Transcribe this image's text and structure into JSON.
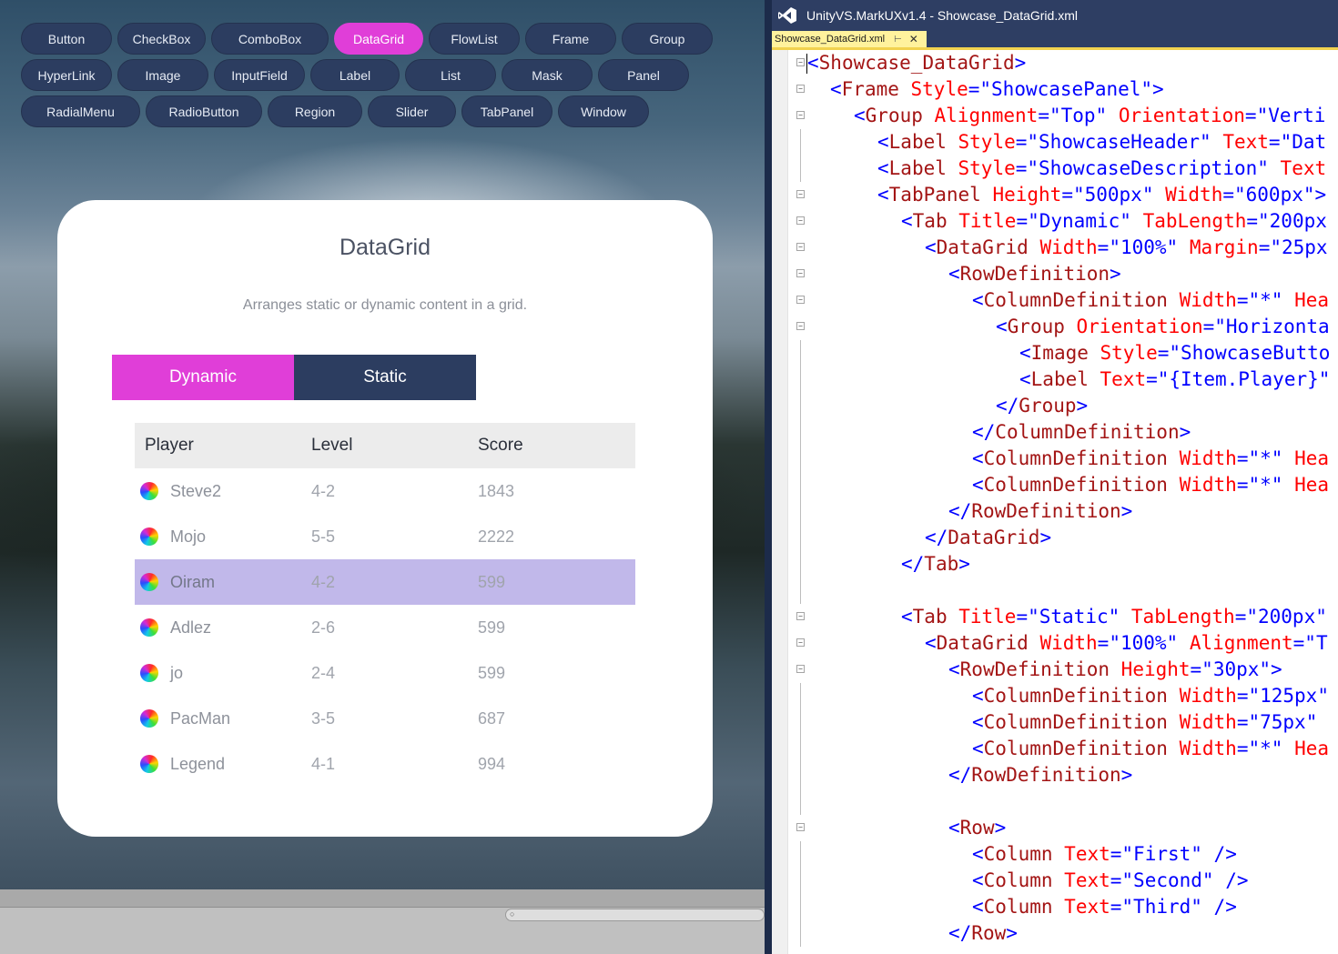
{
  "nav": {
    "rows": [
      [
        "Button",
        "CheckBox",
        "ComboBox",
        "DataGrid",
        "FlowList",
        "Frame",
        "Group"
      ],
      [
        "HyperLink",
        "Image",
        "InputField",
        "Label",
        "List",
        "Mask",
        "Panel"
      ],
      [
        "RadialMenu",
        "RadioButton",
        "Region",
        "Slider",
        "TabPanel",
        "Window"
      ]
    ],
    "active": "DataGrid"
  },
  "showcase": {
    "title": "DataGrid",
    "description": "Arranges static or dynamic content in a grid.",
    "tabs": [
      "Dynamic",
      "Static"
    ],
    "active_tab": "Dynamic",
    "grid": {
      "headers": [
        "Player",
        "Level",
        "Score"
      ],
      "rows": [
        {
          "player": "Steve2",
          "level": "4-2",
          "score": "1843"
        },
        {
          "player": "Mojo",
          "level": "5-5",
          "score": "2222"
        },
        {
          "player": "Oiram",
          "level": "4-2",
          "score": "599",
          "selected": true
        },
        {
          "player": "Adlez",
          "level": "2-6",
          "score": "599"
        },
        {
          "player": "jo",
          "level": "2-4",
          "score": "599"
        },
        {
          "player": "PacMan",
          "level": "3-5",
          "score": "687"
        },
        {
          "player": "Legend",
          "level": "4-1",
          "score": "994"
        }
      ]
    }
  },
  "colors": {
    "accent": "#e03ed8",
    "nav_bg": "#2c3d60",
    "selected_row": "#c1b8ea",
    "vs_titlebar": "#2e3e63",
    "doc_tab": "#fff29d"
  },
  "vs": {
    "window_title": "UnityVS.MarkUXv1.4 - Showcase_DataGrid.xml",
    "doc_tab": "Showcase_DataGrid.xml",
    "code_lines": [
      {
        "indent": 0,
        "fold": true,
        "parts": [
          [
            "p",
            "<"
          ],
          [
            "t",
            "Showcase_DataGrid"
          ],
          [
            "p",
            ">"
          ]
        ]
      },
      {
        "indent": 1,
        "fold": true,
        "parts": [
          [
            "p",
            "<"
          ],
          [
            "t",
            "Frame "
          ],
          [
            "a",
            "Style"
          ],
          [
            "p",
            "=\""
          ],
          [
            "v",
            "ShowcasePanel"
          ],
          [
            "p",
            "\">"
          ]
        ]
      },
      {
        "indent": 2,
        "fold": true,
        "parts": [
          [
            "p",
            "<"
          ],
          [
            "t",
            "Group "
          ],
          [
            "a",
            "Alignment"
          ],
          [
            "p",
            "=\""
          ],
          [
            "v",
            "Top"
          ],
          [
            "p",
            "\" "
          ],
          [
            "a",
            "Orientation"
          ],
          [
            "p",
            "=\""
          ],
          [
            "v",
            "Verti"
          ]
        ]
      },
      {
        "indent": 3,
        "fold": false,
        "parts": [
          [
            "p",
            "<"
          ],
          [
            "t",
            "Label "
          ],
          [
            "a",
            "Style"
          ],
          [
            "p",
            "=\""
          ],
          [
            "v",
            "ShowcaseHeader"
          ],
          [
            "p",
            "\" "
          ],
          [
            "a",
            "Text"
          ],
          [
            "p",
            "=\""
          ],
          [
            "v",
            "Dat"
          ]
        ]
      },
      {
        "indent": 3,
        "fold": false,
        "parts": [
          [
            "p",
            "<"
          ],
          [
            "t",
            "Label "
          ],
          [
            "a",
            "Style"
          ],
          [
            "p",
            "=\""
          ],
          [
            "v",
            "ShowcaseDescription"
          ],
          [
            "p",
            "\" "
          ],
          [
            "a",
            "Text"
          ]
        ]
      },
      {
        "indent": 3,
        "fold": true,
        "parts": [
          [
            "p",
            "<"
          ],
          [
            "t",
            "TabPanel "
          ],
          [
            "a",
            "Height"
          ],
          [
            "p",
            "=\""
          ],
          [
            "v",
            "500px"
          ],
          [
            "p",
            "\" "
          ],
          [
            "a",
            "Width"
          ],
          [
            "p",
            "=\""
          ],
          [
            "v",
            "600px"
          ],
          [
            "p",
            "\">"
          ]
        ]
      },
      {
        "indent": 4,
        "fold": true,
        "parts": [
          [
            "p",
            "<"
          ],
          [
            "t",
            "Tab "
          ],
          [
            "a",
            "Title"
          ],
          [
            "p",
            "=\""
          ],
          [
            "v",
            "Dynamic"
          ],
          [
            "p",
            "\" "
          ],
          [
            "a",
            "TabLength"
          ],
          [
            "p",
            "=\""
          ],
          [
            "v",
            "200px"
          ]
        ]
      },
      {
        "indent": 5,
        "fold": true,
        "parts": [
          [
            "p",
            "<"
          ],
          [
            "t",
            "DataGrid "
          ],
          [
            "a",
            "Width"
          ],
          [
            "p",
            "=\""
          ],
          [
            "v",
            "100%"
          ],
          [
            "p",
            "\" "
          ],
          [
            "a",
            "Margin"
          ],
          [
            "p",
            "=\""
          ],
          [
            "v",
            "25px"
          ]
        ]
      },
      {
        "indent": 6,
        "fold": true,
        "parts": [
          [
            "p",
            "<"
          ],
          [
            "t",
            "RowDefinition"
          ],
          [
            "p",
            ">"
          ]
        ]
      },
      {
        "indent": 7,
        "fold": true,
        "parts": [
          [
            "p",
            "<"
          ],
          [
            "t",
            "ColumnDefinition "
          ],
          [
            "a",
            "Width"
          ],
          [
            "p",
            "=\""
          ],
          [
            "v",
            "*"
          ],
          [
            "p",
            "\" "
          ],
          [
            "a",
            "Hea"
          ]
        ]
      },
      {
        "indent": 8,
        "fold": true,
        "parts": [
          [
            "p",
            "<"
          ],
          [
            "t",
            "Group "
          ],
          [
            "a",
            "Orientation"
          ],
          [
            "p",
            "=\""
          ],
          [
            "v",
            "Horizonta"
          ]
        ]
      },
      {
        "indent": 9,
        "fold": false,
        "parts": [
          [
            "p",
            "<"
          ],
          [
            "t",
            "Image "
          ],
          [
            "a",
            "Style"
          ],
          [
            "p",
            "=\""
          ],
          [
            "v",
            "ShowcaseButto"
          ]
        ]
      },
      {
        "indent": 9,
        "fold": false,
        "parts": [
          [
            "p",
            "<"
          ],
          [
            "t",
            "Label "
          ],
          [
            "a",
            "Text"
          ],
          [
            "p",
            "=\""
          ],
          [
            "v",
            "{Item.Player}"
          ],
          [
            "p",
            "\""
          ]
        ]
      },
      {
        "indent": 8,
        "fold": false,
        "parts": [
          [
            "p",
            "</"
          ],
          [
            "t",
            "Group"
          ],
          [
            "p",
            ">"
          ]
        ]
      },
      {
        "indent": 7,
        "fold": false,
        "parts": [
          [
            "p",
            "</"
          ],
          [
            "t",
            "ColumnDefinition"
          ],
          [
            "p",
            ">"
          ]
        ]
      },
      {
        "indent": 7,
        "fold": false,
        "parts": [
          [
            "p",
            "<"
          ],
          [
            "t",
            "ColumnDefinition "
          ],
          [
            "a",
            "Width"
          ],
          [
            "p",
            "=\""
          ],
          [
            "v",
            "*"
          ],
          [
            "p",
            "\" "
          ],
          [
            "a",
            "Hea"
          ]
        ]
      },
      {
        "indent": 7,
        "fold": false,
        "parts": [
          [
            "p",
            "<"
          ],
          [
            "t",
            "ColumnDefinition "
          ],
          [
            "a",
            "Width"
          ],
          [
            "p",
            "=\""
          ],
          [
            "v",
            "*"
          ],
          [
            "p",
            "\" "
          ],
          [
            "a",
            "Hea"
          ]
        ]
      },
      {
        "indent": 6,
        "fold": false,
        "parts": [
          [
            "p",
            "</"
          ],
          [
            "t",
            "RowDefinition"
          ],
          [
            "p",
            ">"
          ]
        ]
      },
      {
        "indent": 5,
        "fold": false,
        "parts": [
          [
            "p",
            "</"
          ],
          [
            "t",
            "DataGrid"
          ],
          [
            "p",
            ">"
          ]
        ]
      },
      {
        "indent": 4,
        "fold": false,
        "parts": [
          [
            "p",
            "</"
          ],
          [
            "t",
            "Tab"
          ],
          [
            "p",
            ">"
          ]
        ]
      },
      {
        "indent": 0,
        "fold": false,
        "parts": []
      },
      {
        "indent": 4,
        "fold": true,
        "parts": [
          [
            "p",
            "<"
          ],
          [
            "t",
            "Tab "
          ],
          [
            "a",
            "Title"
          ],
          [
            "p",
            "=\""
          ],
          [
            "v",
            "Static"
          ],
          [
            "p",
            "\" "
          ],
          [
            "a",
            "TabLength"
          ],
          [
            "p",
            "=\""
          ],
          [
            "v",
            "200px"
          ],
          [
            "p",
            "\""
          ]
        ]
      },
      {
        "indent": 5,
        "fold": true,
        "parts": [
          [
            "p",
            "<"
          ],
          [
            "t",
            "DataGrid "
          ],
          [
            "a",
            "Width"
          ],
          [
            "p",
            "=\""
          ],
          [
            "v",
            "100%"
          ],
          [
            "p",
            "\" "
          ],
          [
            "a",
            "Alignment"
          ],
          [
            "p",
            "=\""
          ],
          [
            "v",
            "T"
          ]
        ]
      },
      {
        "indent": 6,
        "fold": true,
        "parts": [
          [
            "p",
            "<"
          ],
          [
            "t",
            "RowDefinition "
          ],
          [
            "a",
            "Height"
          ],
          [
            "p",
            "=\""
          ],
          [
            "v",
            "30px"
          ],
          [
            "p",
            "\">"
          ]
        ]
      },
      {
        "indent": 7,
        "fold": false,
        "parts": [
          [
            "p",
            "<"
          ],
          [
            "t",
            "ColumnDefinition "
          ],
          [
            "a",
            "Width"
          ],
          [
            "p",
            "=\""
          ],
          [
            "v",
            "125px"
          ],
          [
            "p",
            "\""
          ]
        ]
      },
      {
        "indent": 7,
        "fold": false,
        "parts": [
          [
            "p",
            "<"
          ],
          [
            "t",
            "ColumnDefinition "
          ],
          [
            "a",
            "Width"
          ],
          [
            "p",
            "=\""
          ],
          [
            "v",
            "75px"
          ],
          [
            "p",
            "\""
          ]
        ]
      },
      {
        "indent": 7,
        "fold": false,
        "parts": [
          [
            "p",
            "<"
          ],
          [
            "t",
            "ColumnDefinition "
          ],
          [
            "a",
            "Width"
          ],
          [
            "p",
            "=\""
          ],
          [
            "v",
            "*"
          ],
          [
            "p",
            "\" "
          ],
          [
            "a",
            "Hea"
          ]
        ]
      },
      {
        "indent": 6,
        "fold": false,
        "parts": [
          [
            "p",
            "</"
          ],
          [
            "t",
            "RowDefinition"
          ],
          [
            "p",
            ">"
          ]
        ]
      },
      {
        "indent": 0,
        "fold": false,
        "parts": []
      },
      {
        "indent": 6,
        "fold": true,
        "parts": [
          [
            "p",
            "<"
          ],
          [
            "t",
            "Row"
          ],
          [
            "p",
            ">"
          ]
        ]
      },
      {
        "indent": 7,
        "fold": false,
        "parts": [
          [
            "p",
            "<"
          ],
          [
            "t",
            "Column "
          ],
          [
            "a",
            "Text"
          ],
          [
            "p",
            "=\""
          ],
          [
            "v",
            "First"
          ],
          [
            "p",
            "\" />"
          ]
        ]
      },
      {
        "indent": 7,
        "fold": false,
        "parts": [
          [
            "p",
            "<"
          ],
          [
            "t",
            "Column "
          ],
          [
            "a",
            "Text"
          ],
          [
            "p",
            "=\""
          ],
          [
            "v",
            "Second"
          ],
          [
            "p",
            "\" />"
          ]
        ]
      },
      {
        "indent": 7,
        "fold": false,
        "parts": [
          [
            "p",
            "<"
          ],
          [
            "t",
            "Column "
          ],
          [
            "a",
            "Text"
          ],
          [
            "p",
            "=\""
          ],
          [
            "v",
            "Third"
          ],
          [
            "p",
            "\" />"
          ]
        ]
      },
      {
        "indent": 6,
        "fold": false,
        "parts": [
          [
            "p",
            "</"
          ],
          [
            "t",
            "Row"
          ],
          [
            "p",
            ">"
          ]
        ]
      }
    ]
  }
}
